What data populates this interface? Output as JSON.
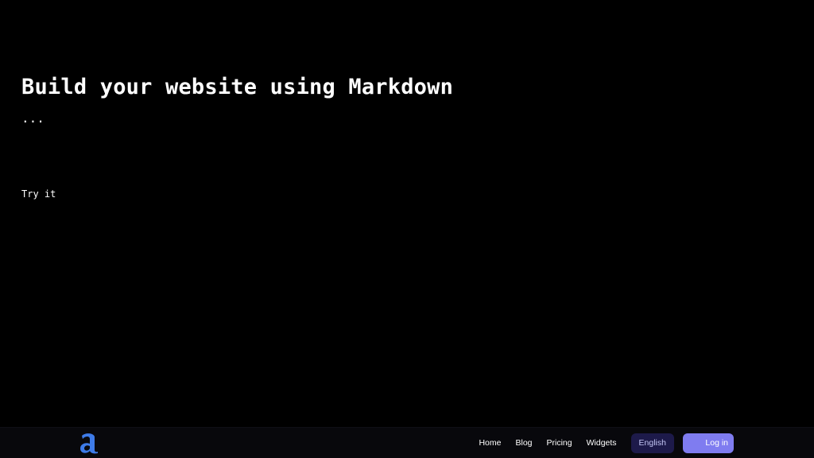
{
  "hero": {
    "title": "Build your website using Markdown",
    "ellipsis": "...",
    "cta_label": "Try it"
  },
  "navbar": {
    "logo_icon": "markdown-a-logo-icon",
    "links": [
      "Home",
      "Blog",
      "Pricing",
      "Widgets"
    ],
    "language_label": "English",
    "login_label": "Log in"
  },
  "colors": {
    "background": "#000000",
    "navbar_background": "#08080c",
    "logo_blue": "#3e7be8",
    "language_button_bg": "#1d1a4a",
    "login_button_bg": "#7f7cf0"
  }
}
